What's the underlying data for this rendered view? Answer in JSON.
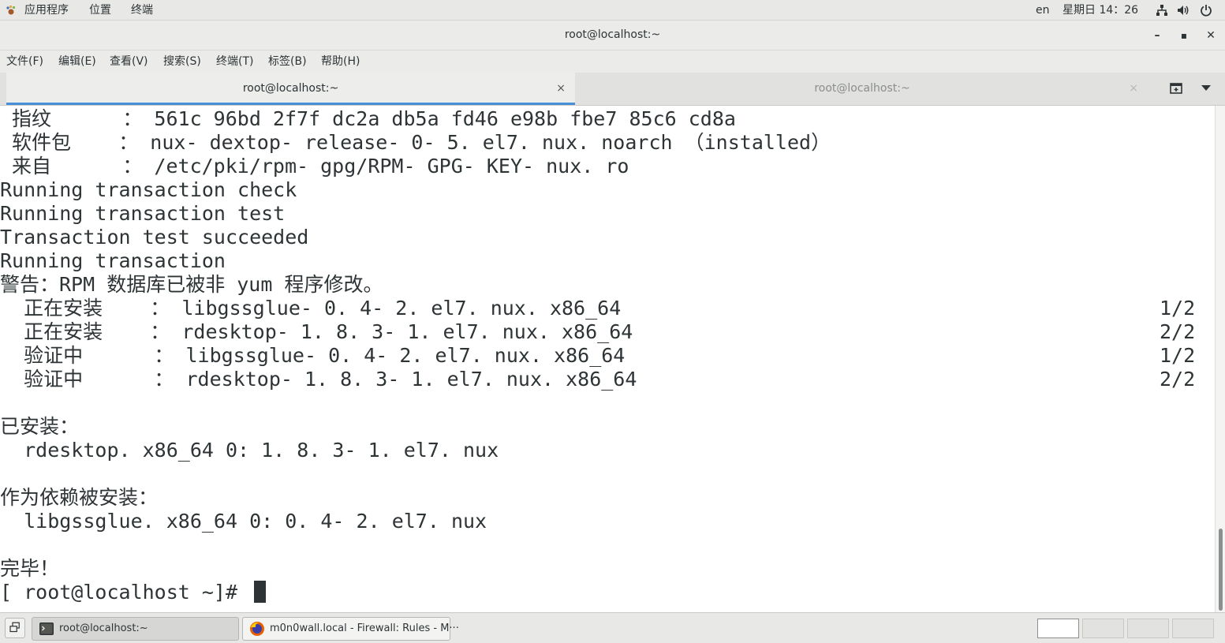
{
  "topbar": {
    "applications": "应用程序",
    "places": "位置",
    "terminal": "终端",
    "language": "en",
    "clock": "星期日 14：26"
  },
  "window": {
    "title": "root@localhost:~",
    "minimize": "–",
    "maximize": "▪",
    "close": "✕"
  },
  "menu": {
    "items": [
      "文件(F)",
      "编辑(E)",
      "查看(V)",
      "搜索(S)",
      "终端(T)",
      "标签(B)",
      "帮助(H)"
    ]
  },
  "tabs": [
    {
      "label": "root@localhost:~",
      "close": "×",
      "active": true
    },
    {
      "label": "root@localhost:~",
      "close": "×",
      "active": false
    }
  ],
  "terminal": {
    "lines": [
      {
        "text": " 指纹      ： 561c 96bd 2f7f dc2a db5a fd46 e98b fbe7 85c6 cd8a",
        "right": ""
      },
      {
        "text": " 软件包    ： nux- dextop- release- 0- 5. el7. nux. noarch （installed）",
        "right": ""
      },
      {
        "text": " 来自      ： /etc/pki/rpm- gpg/RPM- GPG- KEY- nux. ro",
        "right": ""
      },
      {
        "text": "Running transaction check",
        "right": ""
      },
      {
        "text": "Running transaction test",
        "right": ""
      },
      {
        "text": "Transaction test succeeded",
        "right": ""
      },
      {
        "text": "Running transaction",
        "right": ""
      },
      {
        "text": "警告：RPM 数据库已被非 yum 程序修改。",
        "right": ""
      },
      {
        "text": "  正在安装    ： libgssglue- 0. 4- 2. el7. nux. x86_64",
        "right": "1/2"
      },
      {
        "text": "  正在安装    ： rdesktop- 1. 8. 3- 1. el7. nux. x86_64",
        "right": "2/2"
      },
      {
        "text": "  验证中      ： libgssglue- 0. 4- 2. el7. nux. x86_64",
        "right": "1/2"
      },
      {
        "text": "  验证中      ： rdesktop- 1. 8. 3- 1. el7. nux. x86_64",
        "right": "2/2"
      },
      {
        "text": "",
        "right": ""
      },
      {
        "text": "已安装：",
        "right": ""
      },
      {
        "text": "  rdesktop. x86_64 0: 1. 8. 3- 1. el7. nux",
        "right": ""
      },
      {
        "text": "",
        "right": ""
      },
      {
        "text": "作为依赖被安装：",
        "right": ""
      },
      {
        "text": "  libgssglue. x86_64 0: 0. 4- 2. el7. nux",
        "right": ""
      },
      {
        "text": "",
        "right": ""
      },
      {
        "text": "完毕！",
        "right": ""
      }
    ],
    "prompt": "[ root@localhost ~]# "
  },
  "taskbar": {
    "tasks": [
      {
        "label": "root@localhost:~",
        "icon": "terminal-icon"
      },
      {
        "label": "m0n0wall.local - Firewall: Rules - M···",
        "icon": "firefox-icon"
      }
    ]
  },
  "colors": {
    "accent": "#4a90d9",
    "terminal_fg": "#2e3436",
    "terminal_bg": "#ffffff"
  }
}
